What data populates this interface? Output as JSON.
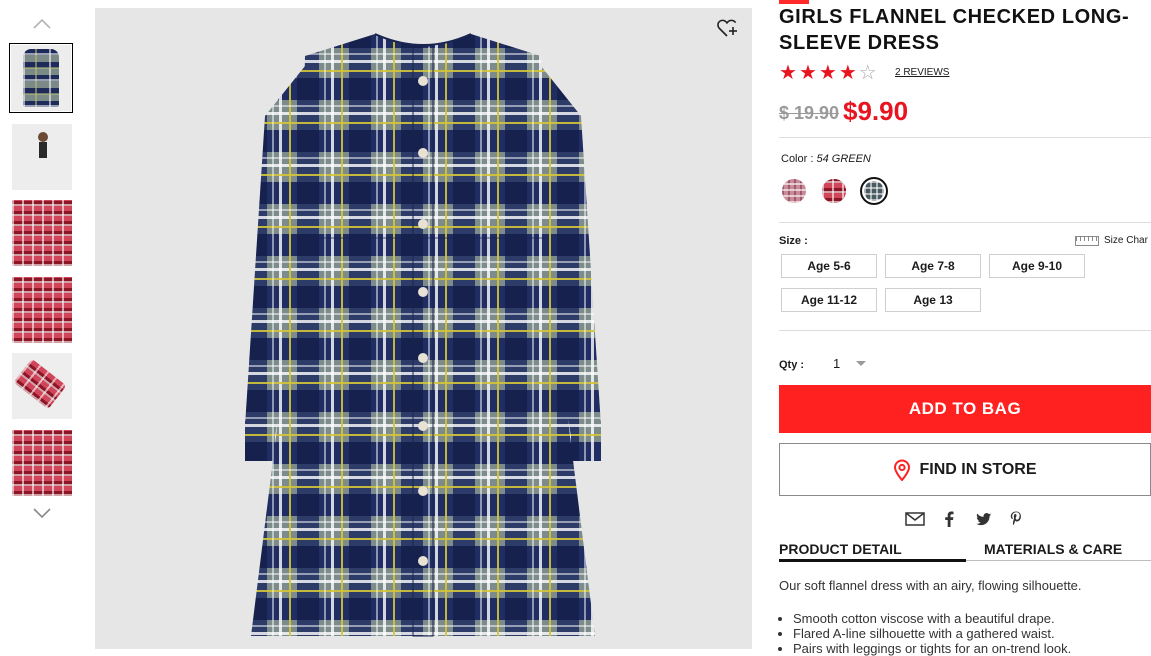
{
  "product": {
    "title": "GIRLS FLANNEL CHECKED LONG-SLEEVE DRESS",
    "rating": 4,
    "rating_max": 5,
    "reviews_label": "2 REVIEWS",
    "price_old": "$ 19.90",
    "price_new": "$9.90"
  },
  "color": {
    "label": "Color :",
    "value": "54 GREEN",
    "swatches": [
      {
        "name": "pink-check",
        "selected": false
      },
      {
        "name": "red-check",
        "selected": false
      },
      {
        "name": "green-check",
        "selected": true
      }
    ]
  },
  "size": {
    "label": "Size :",
    "chart_label": "Size Char",
    "options": [
      "Age 5-6",
      "Age 7-8",
      "Age 9-10",
      "Age 11-12",
      "Age 13"
    ]
  },
  "qty": {
    "label": "Qty :",
    "value": "1"
  },
  "actions": {
    "add_to_bag": "ADD TO BAG",
    "find_in_store": "FIND IN STORE"
  },
  "share_icons": [
    "mail-icon",
    "facebook-icon",
    "twitter-icon",
    "pinterest-icon"
  ],
  "tabs": [
    {
      "label": "PRODUCT DETAIL",
      "active": true
    },
    {
      "label": "MATERIALS & CARE",
      "active": false
    }
  ],
  "detail": {
    "description": "Our soft flannel dress with an airy, flowing silhouette.",
    "bullets": [
      "Smooth cotton viscose with a beautiful drape.",
      "Flared A-line silhouette with a gathered waist.",
      "Pairs with leggings or tights for an on-trend look."
    ]
  },
  "colors": {
    "accent": "#ff2020",
    "price_red": "#e8141f",
    "image_bg": "#e6e6e6"
  }
}
